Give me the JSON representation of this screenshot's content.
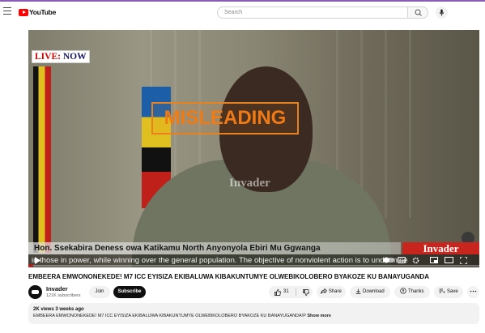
{
  "masthead": {
    "logo_text": "YouTube",
    "search_placeholder": "Search"
  },
  "player": {
    "live_badge_part1": "LIVE:",
    "live_badge_part2": "NOW",
    "overlay_label": "MISLEADING",
    "watermark": "Invader",
    "lower_third_name": "Hon. Ssekabira Deness owa Katikamu North Anyonyola Ebiri Mu Ggwanga",
    "brand_box": "Invader",
    "ticker_text": "in those in power, while winning over the general population.  The objective of nonviolent action is to undermine",
    "progress": 0.01
  },
  "video": {
    "title": "EMBEERA EMWONONEKEDE! M7 ICC EYISIZA EKIBALUWA KIBAKUNTUMYE OLWEBIKOLOBERO BYAKOZE KU BANAYUGANDA",
    "channel_name": "Invader",
    "subscribers": "121K subscribers",
    "join_label": "Join",
    "subscribe_label": "Subscribe",
    "like_count": "31",
    "share_label": "Share",
    "download_label": "Download",
    "thanks_label": "Thanks",
    "save_label": "Save"
  },
  "description": {
    "meta": "2K views  3 weeks ago",
    "text": "EMBEERA EMWONONEKEDE! M7 ICC EYISIZA EKIBALUWA KIBAKUNTUMYE OLWEBIKOLOBERO BYAKOZE KU BANAYUGANDA!P",
    "show_more": "Show more"
  }
}
